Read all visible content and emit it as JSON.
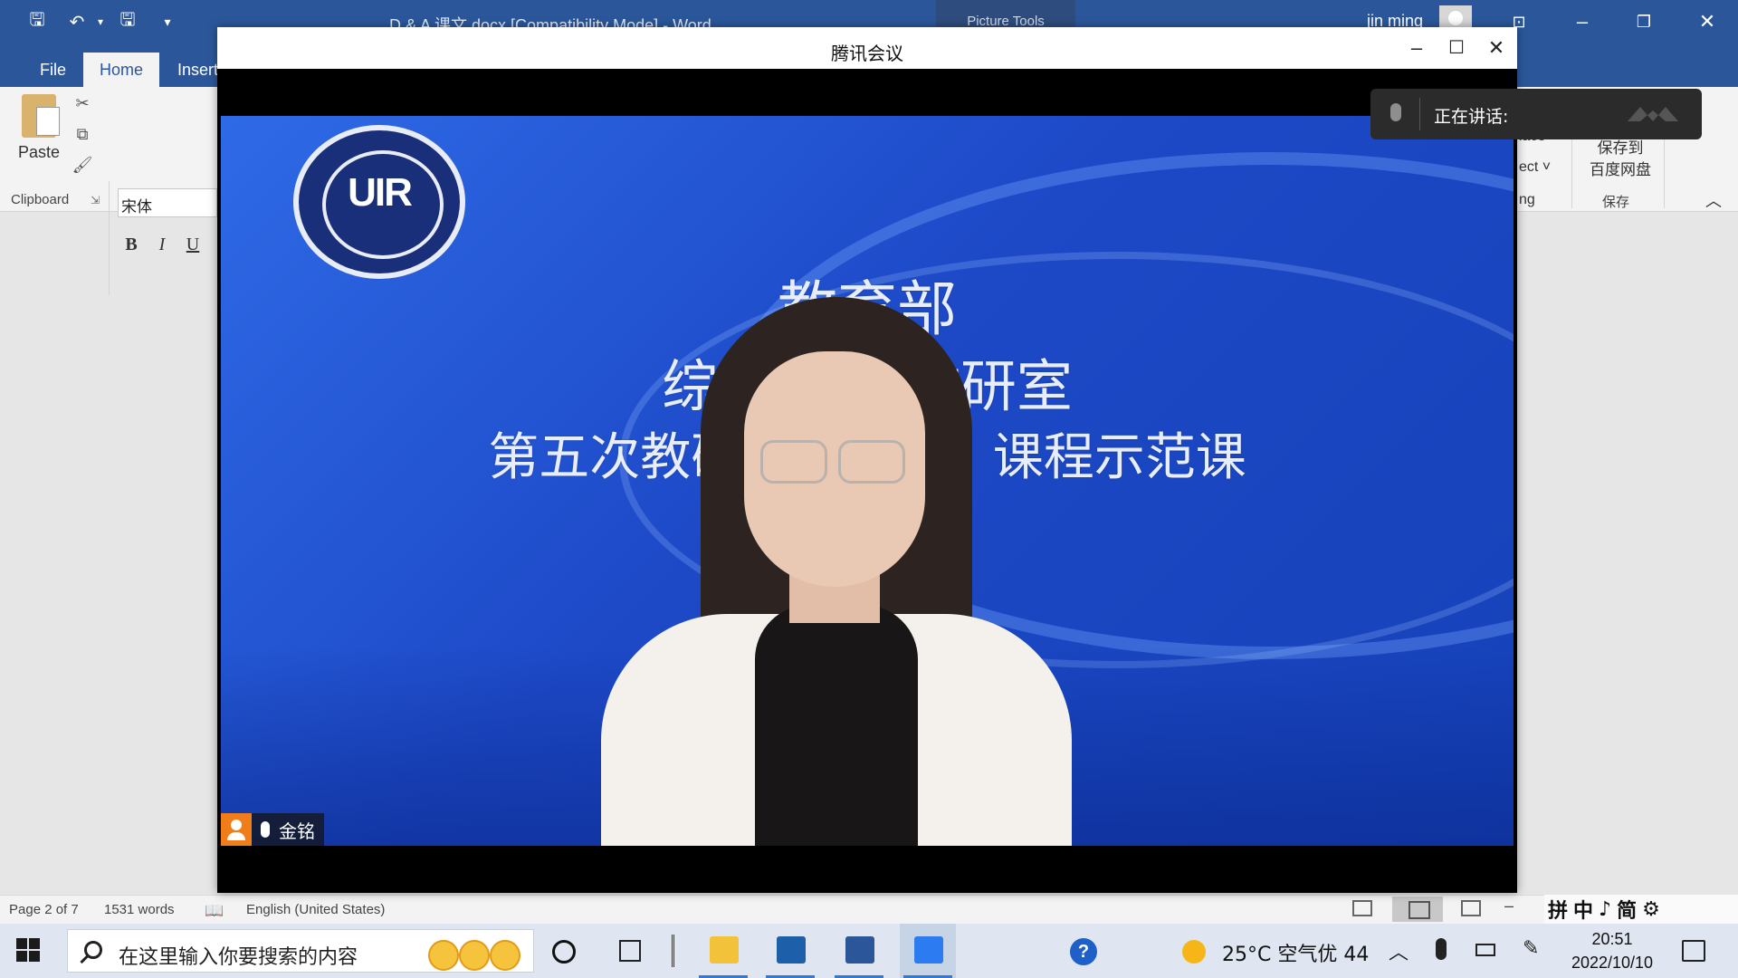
{
  "word": {
    "title": "D & A 课文.docx [Compatibility Mode]  -  Word",
    "picture_tools": "Picture Tools",
    "user": "jin ming",
    "tabs": [
      "File",
      "Home",
      "Insert"
    ],
    "ribbon": {
      "paste": "Paste",
      "clipboard_group": "Clipboard",
      "font_name": "宋体",
      "bold": "B",
      "italic": "I",
      "underline": "U",
      "replace_fragment": "lace",
      "select_fragment": "ect ˅",
      "editing_fragment": "ng",
      "save_cloud": "保存到\n百度网盘",
      "save_group": "保存"
    },
    "status": {
      "page": "Page 2 of 7",
      "words": "1531 words",
      "language": "English (United States)"
    },
    "ime": [
      "拼",
      "中",
      "♪",
      "简",
      "⚙"
    ]
  },
  "meeting": {
    "title": "腾讯会议",
    "speaking_label": "正在讲话:",
    "participant_name": "金铭",
    "slide": {
      "logo_text": "UIR",
      "line1": "教育部",
      "line2": "综合英语                   教研室",
      "line3": "第五次教研活动              语1》课程示范课"
    }
  },
  "taskbar": {
    "search_placeholder": "在这里输入你要搜索的内容",
    "weather": "25°C  空气优 44",
    "time": "20:51",
    "date": "2022/10/10"
  },
  "colors": {
    "word_blue": "#2b579a",
    "slide_blue": "#1d49c7",
    "name_tag_orange": "#f07c1a"
  }
}
